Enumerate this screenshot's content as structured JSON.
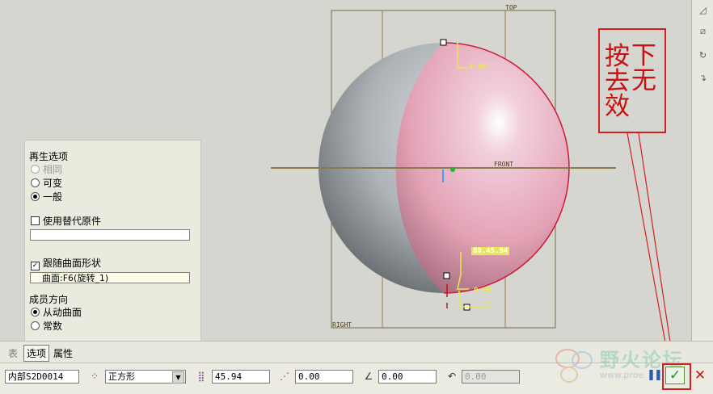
{
  "viewport": {
    "datum_top": "TOP",
    "datum_front": "FRONT",
    "datum_right": "RIGHT",
    "dim_top": "0.00",
    "dim_angle": "80.45.94",
    "dim_bottom": "0.00"
  },
  "annotation": {
    "text_col1": "按去效",
    "text_col2": "下无"
  },
  "options_panel": {
    "regen_title": "再生选项",
    "regen_same": "相同",
    "regen_variable": "可变",
    "regen_general": "一般",
    "use_substitute_label": "使用替代原件",
    "substitute_value": "",
    "follow_surface_label": "跟随曲面形状",
    "surface_value": "曲面:F6(旋转_1)",
    "member_direction_title": "成员方向",
    "direction_driven": "从动曲面",
    "direction_constant": "常数"
  },
  "tabs": {
    "table": "表",
    "options": "选项",
    "properties": "属性"
  },
  "dashboard": {
    "sketch_name": "内部S2D0014",
    "pattern_shape": "正方形",
    "spacing": "45.94",
    "offset": "0.00",
    "angle": "0.00",
    "rotation": "0.00"
  },
  "watermark": {
    "text": "野火论坛",
    "url": "www.proe"
  },
  "colors": {
    "sphere_pink": "#e6a3b4",
    "sphere_gray": "#a9aeb2",
    "accent_red": "#d42020",
    "ok_green": "#1a9a2a"
  }
}
